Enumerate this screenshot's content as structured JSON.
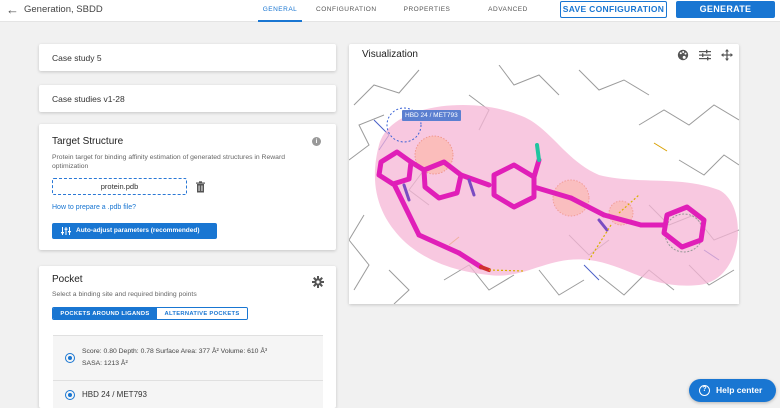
{
  "app": {
    "back_icon": "arrow-left-icon",
    "title": "Generation, SBDD"
  },
  "tabs": [
    {
      "label": "GENERAL",
      "active": true
    },
    {
      "label": "CONFIGURATION",
      "active": false
    },
    {
      "label": "PROPERTIES",
      "active": false
    },
    {
      "label": "ADVANCED",
      "active": false
    }
  ],
  "actions": {
    "save_label": "SAVE CONFIGURATION",
    "generate_label": "GENERATE"
  },
  "cards": {
    "case_study": "Case study 5",
    "case_studies": "Case studies v1-28"
  },
  "target": {
    "title": "Target Structure",
    "description": "Protein target for binding affinity estimation of generated structures in Reward optimization",
    "file_name": "protein.pdb",
    "link": "How to prepare a .pdb file?",
    "auto_button": "Auto-adjust parameters (recommended)"
  },
  "pocket": {
    "title": "Pocket",
    "subtitle": "Select a binding site and required binding points",
    "toggle_on": "POCKETS AROUND LIGANDS",
    "toggle_off": "ALTERNATIVE POCKETS",
    "option1_line1": "Score: 0.80    Depth: 0.78    Surface Area: 377 Å²    Volume: 610 Å³",
    "option1_line2": "SASA: 1213 Å²",
    "option2_label": "HBD 24 / MET793"
  },
  "visualization": {
    "title": "Visualization",
    "residue_label": "HBD 24 / MET793",
    "tools": [
      "palette-icon",
      "sliders-icon",
      "move-icon"
    ]
  },
  "help": {
    "label": "Help center"
  },
  "colors": {
    "accent": "#1976d2",
    "ligand": "#e01fb8",
    "surface": "#f5b6d6",
    "label_bg": "#5b7fd0"
  }
}
